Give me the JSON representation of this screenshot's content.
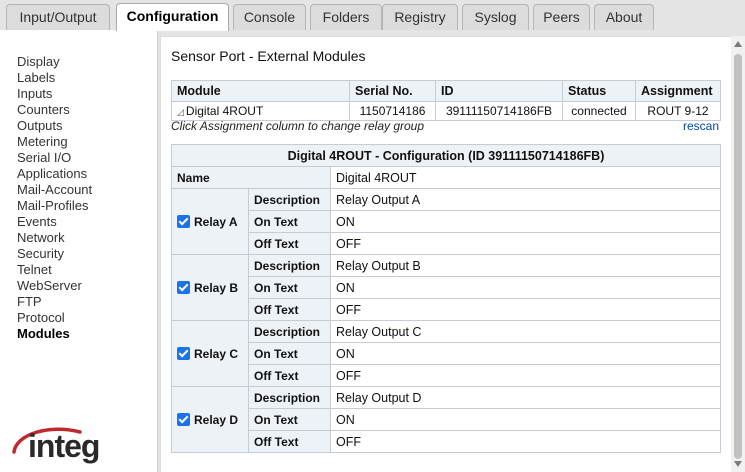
{
  "tabs": [
    "Input/Output",
    "Configuration",
    "Console",
    "Folders",
    "Registry",
    "Syslog",
    "Peers",
    "About"
  ],
  "active_tab": "Configuration",
  "sidebar": {
    "items": [
      "Display",
      "Labels",
      "Inputs",
      "Counters",
      "Outputs",
      "Metering",
      "Serial I/O",
      "Applications",
      "Mail-Account",
      "Mail-Profiles",
      "Events",
      "Network",
      "Security",
      "Telnet",
      "WebServer",
      "FTP",
      "Protocol",
      "Modules"
    ],
    "active": "Modules"
  },
  "logo": "integ",
  "main": {
    "title": "Sensor Port - External Modules",
    "modules_table": {
      "headers": [
        "Module",
        "Serial No.",
        "ID",
        "Status",
        "Assignment"
      ],
      "rows": [
        {
          "module": "Digital 4ROUT",
          "serial": "1150714186",
          "id": "39111150714186FB",
          "status": "connected",
          "assignment": "ROUT 9-12"
        }
      ]
    },
    "hint": "Click Assignment column to change relay group",
    "rescan": "rescan",
    "config": {
      "title": "Digital 4ROUT - Configuration (ID 39111150714186FB)",
      "name_label": "Name",
      "name_value": "Digital 4ROUT",
      "labels": {
        "description": "Description",
        "on_text": "On Text",
        "off_text": "Off Text"
      },
      "relays": [
        {
          "label": "Relay A",
          "checked": true,
          "description": "Relay Output A",
          "on_text": "ON",
          "off_text": "OFF"
        },
        {
          "label": "Relay B",
          "checked": true,
          "description": "Relay Output B",
          "on_text": "ON",
          "off_text": "OFF"
        },
        {
          "label": "Relay C",
          "checked": true,
          "description": "Relay Output C",
          "on_text": "ON",
          "off_text": "OFF"
        },
        {
          "label": "Relay D",
          "checked": true,
          "description": "Relay Output D",
          "on_text": "ON",
          "off_text": "OFF"
        }
      ]
    }
  },
  "colors": {
    "accent": "#1a73e8",
    "link": "#0645ad",
    "header_bg": "#edf2f7",
    "logo_red": "#c0282d"
  }
}
